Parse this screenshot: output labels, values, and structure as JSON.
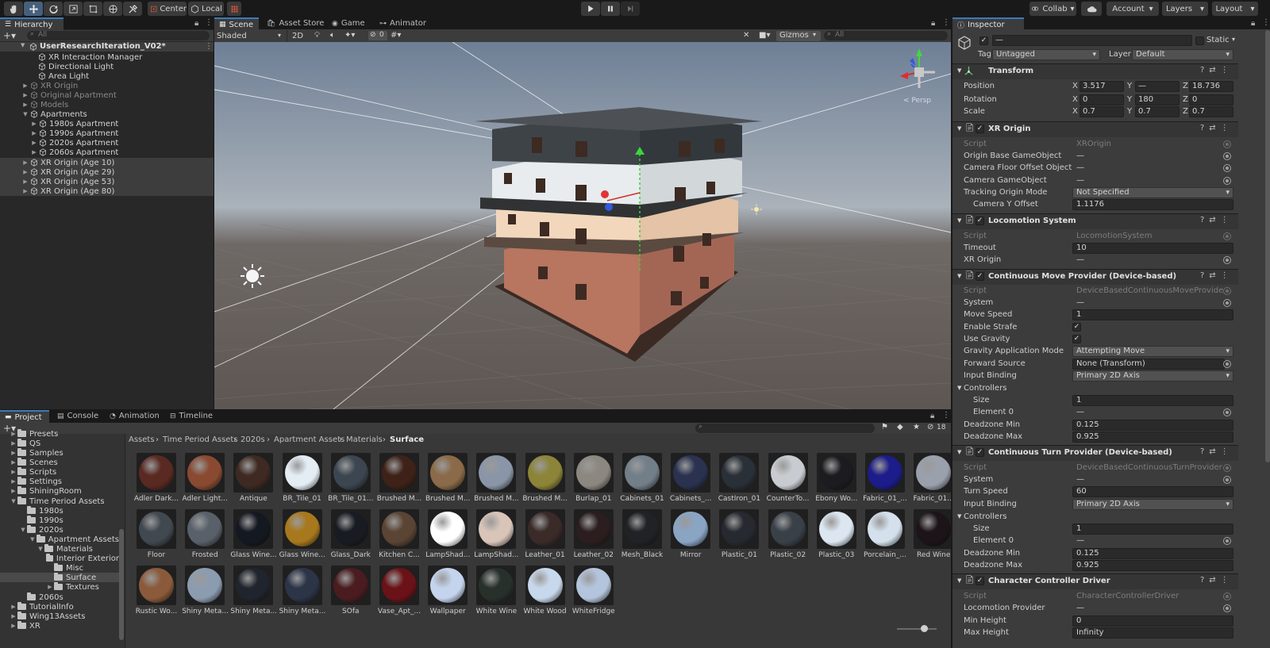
{
  "toolbar": {
    "pivot_label": "Center",
    "space_label": "Local",
    "collab_label": "Collab",
    "account_label": "Account",
    "layers_label": "Layers",
    "layout_label": "Layout"
  },
  "hierarchy": {
    "tab": "Hierarchy",
    "search_placeholder": "All",
    "scene_name": "UserResearchIteration_V02*",
    "items": [
      {
        "label": "XR Interaction Manager"
      },
      {
        "label": "Directional Light"
      },
      {
        "label": "Area Light"
      },
      {
        "label": "XR Origin"
      },
      {
        "label": "Original Apartment"
      },
      {
        "label": "Models"
      },
      {
        "label": "Apartments"
      },
      {
        "label": "1980s Apartment"
      },
      {
        "label": "1990s Apartment"
      },
      {
        "label": "2020s Apartment"
      },
      {
        "label": "2060s Apartment"
      },
      {
        "label": "XR Origin (Age 10)"
      },
      {
        "label": "XR Origin (Age 29)"
      },
      {
        "label": "XR Origin (Age 53)"
      },
      {
        "label": "XR Origin (Age 80)"
      }
    ]
  },
  "scene_tabs": [
    {
      "label": "Scene"
    },
    {
      "label": "Asset Store"
    },
    {
      "label": "Game"
    },
    {
      "label": "Animator"
    }
  ],
  "scene_toolbar": {
    "shading_mode": "Shaded",
    "mode_2d": "2D",
    "hidden_count": "0",
    "gizmos_label": "Gizmos",
    "search_placeholder": "All"
  },
  "scene_view": {
    "persp_label": "< Persp"
  },
  "inspector": {
    "tab": "Inspector",
    "object_name": "—",
    "static_label": "Static",
    "tag_label": "Tag",
    "tag_value": "Untagged",
    "layer_label": "Layer",
    "layer_value": "Default",
    "transform": {
      "title": "Transform",
      "position_label": "Position",
      "rotation_label": "Rotation",
      "scale_label": "Scale",
      "position": {
        "x": "3.517",
        "y": "—",
        "z": "18.736"
      },
      "rotation": {
        "x": "0",
        "y": "180",
        "z": "0"
      },
      "scale": {
        "x": "0.7",
        "y": "0.7",
        "z": "0.7"
      }
    },
    "xr_origin": {
      "title": "XR Origin",
      "script_label": "Script",
      "script_value": "XROrigin",
      "origin_base_label": "Origin Base GameObject",
      "origin_base_value": "—",
      "camera_floor_label": "Camera Floor Offset Object",
      "camera_floor_value": "—",
      "camera_go_label": "Camera GameObject",
      "camera_go_value": "—",
      "tracking_mode_label": "Tracking Origin Mode",
      "tracking_mode_value": "Not Specified",
      "camera_y_label": "Camera Y Offset",
      "camera_y_value": "1.1176"
    },
    "locomotion": {
      "title": "Locomotion System",
      "script_label": "Script",
      "script_value": "LocomotionSystem",
      "timeout_label": "Timeout",
      "timeout_value": "10",
      "xr_origin_label": "XR Origin",
      "xr_origin_value": "—"
    },
    "move": {
      "title": "Continuous Move Provider (Device-based)",
      "script_label": "Script",
      "script_value": "DeviceBasedContinuousMoveProvider",
      "system_label": "System",
      "system_value": "—",
      "speed_label": "Move Speed",
      "speed_value": "1",
      "strafe_label": "Enable Strafe",
      "gravity_label": "Use Gravity",
      "gravity_mode_label": "Gravity Application Mode",
      "gravity_mode_value": "Attempting Move",
      "forward_label": "Forward Source",
      "forward_value": "None (Transform)",
      "binding_label": "Input Binding",
      "binding_value": "Primary 2D Axis",
      "controllers_label": "Controllers",
      "size_label": "Size",
      "size_value": "1",
      "element_label": "Element 0",
      "element_value": "—",
      "dz_min_label": "Deadzone Min",
      "dz_min_value": "0.125",
      "dz_max_label": "Deadzone Max",
      "dz_max_value": "0.925"
    },
    "turn": {
      "title": "Continuous Turn Provider (Device-based)",
      "script_label": "Script",
      "script_value": "DeviceBasedContinuousTurnProvider",
      "system_label": "System",
      "system_value": "—",
      "speed_label": "Turn Speed",
      "speed_value": "60",
      "binding_label": "Input Binding",
      "binding_value": "Primary 2D Axis",
      "controllers_label": "Controllers",
      "size_label": "Size",
      "size_value": "1",
      "element_label": "Element 0",
      "element_value": "—",
      "dz_min_label": "Deadzone Min",
      "dz_min_value": "0.125",
      "dz_max_label": "Deadzone Max",
      "dz_max_value": "0.925"
    },
    "ccd": {
      "title": "Character Controller Driver",
      "script_label": "Script",
      "script_value": "CharacterControllerDriver",
      "provider_label": "Locomotion Provider",
      "provider_value": "—",
      "min_h_label": "Min Height",
      "min_h_value": "0",
      "max_h_label": "Max Height",
      "max_h_value": "Infinity"
    }
  },
  "bottom_tabs": [
    {
      "label": "Project"
    },
    {
      "label": "Console"
    },
    {
      "label": "Animation"
    },
    {
      "label": "Timeline"
    }
  ],
  "project": {
    "hidden_count": "18",
    "tree": [
      {
        "label": "Presets"
      },
      {
        "label": "QS"
      },
      {
        "label": "Samples"
      },
      {
        "label": "Scenes"
      },
      {
        "label": "Scripts"
      },
      {
        "label": "Settings"
      },
      {
        "label": "ShiningRoom"
      },
      {
        "label": "Time Period Assets"
      },
      {
        "label": "1980s"
      },
      {
        "label": "1990s"
      },
      {
        "label": "2020s"
      },
      {
        "label": "Apartment Assets"
      },
      {
        "label": "Materials"
      },
      {
        "label": "Interior Exterior"
      },
      {
        "label": "Misc"
      },
      {
        "label": "Surface"
      },
      {
        "label": "Textures"
      },
      {
        "label": "2060s"
      },
      {
        "label": "TutorialInfo"
      },
      {
        "label": "Wing13Assets"
      },
      {
        "label": "XR"
      }
    ],
    "breadcrumb": [
      "Assets",
      "Time Period Assets",
      "2020s",
      "Apartment Assets",
      "Materials",
      "Surface"
    ],
    "assets": [
      {
        "name": "Adler Dark...",
        "color": "#5a2a22"
      },
      {
        "name": "Adler Light...",
        "color": "#8a4a32"
      },
      {
        "name": "Antique",
        "color": "#3e2a22"
      },
      {
        "name": "BR_Tile_01",
        "color": "#e4ecf4"
      },
      {
        "name": "BR_Tile_01...",
        "color": "#3c4650"
      },
      {
        "name": "Brushed M...",
        "color": "#3e2218"
      },
      {
        "name": "Brushed M...",
        "color": "#8a6a48"
      },
      {
        "name": "Brushed M...",
        "color": "#8a96a8"
      },
      {
        "name": "Brushed M...",
        "color": "#8c8438"
      },
      {
        "name": "Burlap_01",
        "color": "#8c8880"
      },
      {
        "name": "Cabinets_01",
        "color": "#727e88"
      },
      {
        "name": "Cabinets_...",
        "color": "#2a3250"
      },
      {
        "name": "CastIron_01",
        "color": "#2a3038"
      },
      {
        "name": "CounterTo...",
        "color": "#c8ccd0"
      },
      {
        "name": "Ebony Wo...",
        "color": "#1c1c20"
      },
      {
        "name": "Fabric_01_...",
        "color": "#1c1c8a"
      },
      {
        "name": "Fabric_01...",
        "color": "#9aa0ac"
      },
      {
        "name": "Floor",
        "color": "#404850"
      },
      {
        "name": "Frosted",
        "color": "#58606a"
      },
      {
        "name": "Glass Wine...",
        "color": "#141820"
      },
      {
        "name": "Glass Wine...",
        "color": "#a8781c"
      },
      {
        "name": "Glass_Dark",
        "color": "#181c22"
      },
      {
        "name": "Kitchen C...",
        "color": "#5a4434"
      },
      {
        "name": "LampShad...",
        "color": "#ffffff"
      },
      {
        "name": "LampShad...",
        "color": "#d8c4b8"
      },
      {
        "name": "Leather_01",
        "color": "#3a2a28"
      },
      {
        "name": "Leather_02",
        "color": "#2c1e1e"
      },
      {
        "name": "Mesh_Black",
        "color": "#202226"
      },
      {
        "name": "Mirror",
        "color": "#8aa4c4"
      },
      {
        "name": "Plastic_01",
        "color": "#262a30"
      },
      {
        "name": "Plastic_02",
        "color": "#3a4048"
      },
      {
        "name": "Plastic_03",
        "color": "#dce6f0"
      },
      {
        "name": "Porcelain_...",
        "color": "#d4e0ec"
      },
      {
        "name": "Red Wine",
        "color": "#1c1418"
      },
      {
        "name": "Rustic Wo...",
        "color": "#8a5a3a"
      },
      {
        "name": "Shiny Meta...",
        "color": "#8c9cb0"
      },
      {
        "name": "Shiny Meta...",
        "color": "#20242c"
      },
      {
        "name": "Shiny Meta...",
        "color": "#2c3448"
      },
      {
        "name": "SOfa",
        "color": "#4a1c20"
      },
      {
        "name": "Vase_Apt_...",
        "color": "#6a1218"
      },
      {
        "name": "Wallpaper",
        "color": "#c4d4ec"
      },
      {
        "name": "White Wine",
        "color": "#28302c"
      },
      {
        "name": "White Wood",
        "color": "#c8d8ec"
      },
      {
        "name": "WhiteFridge",
        "color": "#b4c4dc"
      }
    ]
  }
}
